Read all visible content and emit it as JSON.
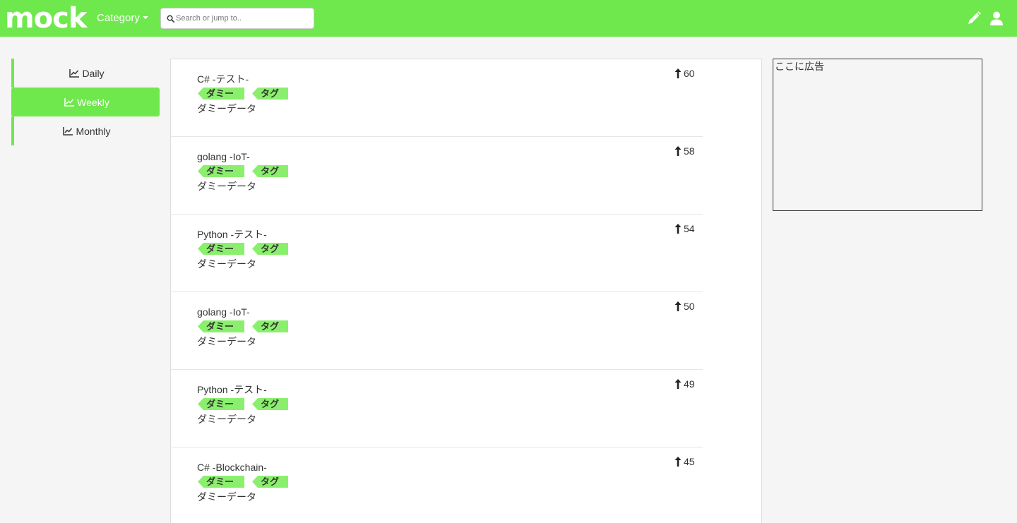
{
  "header": {
    "brand": "mock",
    "category_label": "Category",
    "search_placeholder": "Search or jump to.."
  },
  "sidebar": {
    "items": [
      {
        "label": "Daily",
        "active": false
      },
      {
        "label": "Weekly",
        "active": true
      },
      {
        "label": "Monthly",
        "active": false
      }
    ]
  },
  "articles": [
    {
      "title": "C# -テスト-",
      "tags": [
        "ダミー",
        "タグ"
      ],
      "desc": "ダミーデータ",
      "score": "60"
    },
    {
      "title": "golang -IoT-",
      "tags": [
        "ダミー",
        "タグ"
      ],
      "desc": "ダミーデータ",
      "score": "58"
    },
    {
      "title": "Python -テスト-",
      "tags": [
        "ダミー",
        "タグ"
      ],
      "desc": "ダミーデータ",
      "score": "54"
    },
    {
      "title": "golang -IoT-",
      "tags": [
        "ダミー",
        "タグ"
      ],
      "desc": "ダミーデータ",
      "score": "50"
    },
    {
      "title": "Python -テスト-",
      "tags": [
        "ダミー",
        "タグ"
      ],
      "desc": "ダミーデータ",
      "score": "49"
    },
    {
      "title": "C# -Blockchain-",
      "tags": [
        "ダミー",
        "タグ"
      ],
      "desc": "ダミーデータ",
      "score": "45"
    }
  ],
  "ad": {
    "text": "ここに広告"
  },
  "colors": {
    "accent": "#6fe84d",
    "tag": "#8bef6e"
  },
  "icons": {
    "nav_item": "chart-line-icon",
    "score": "arrow-up-icon",
    "search": "search-icon",
    "edit": "pencil-icon",
    "account": "user-icon"
  }
}
